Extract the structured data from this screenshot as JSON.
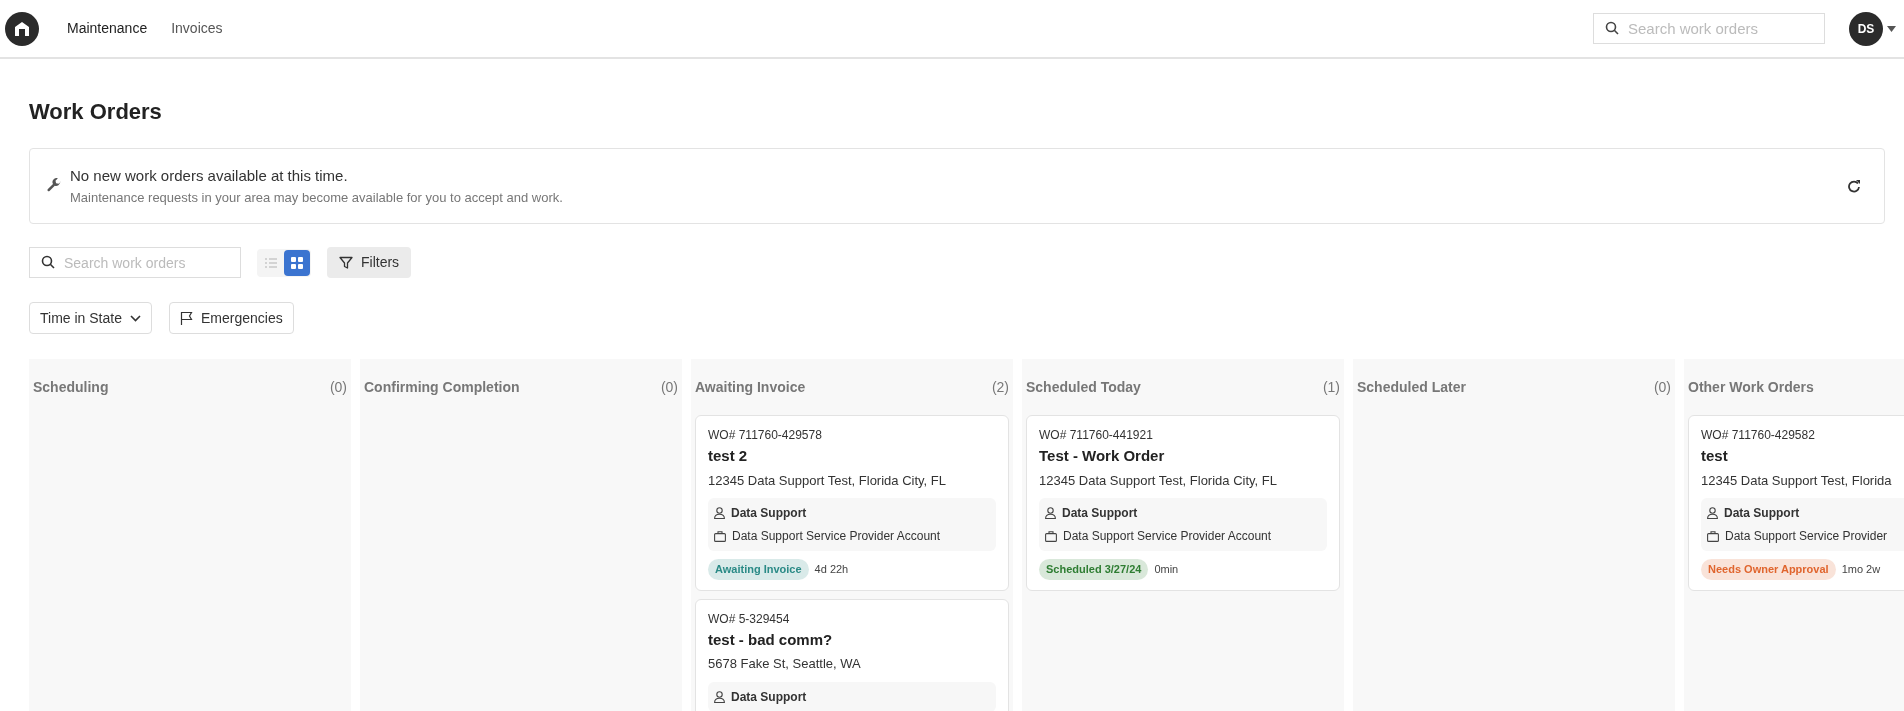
{
  "header": {
    "avatar": "DS",
    "nav": [
      {
        "label": "Maintenance",
        "selected": true
      },
      {
        "label": "Invoices",
        "selected": false
      }
    ],
    "search": {
      "placeholder": "Search work orders"
    }
  },
  "title": "Work Orders",
  "notice": {
    "heading": "No new work orders available at this time.",
    "text": "Maintenance requests in your area may become available for you to accept and work."
  },
  "toolbar": {
    "search": {
      "placeholder": "Search work orders"
    },
    "views": [
      {
        "kind": "list",
        "selected": false
      },
      {
        "kind": "grid",
        "selected": true
      }
    ],
    "filters": "Filters",
    "sort": "Time in State",
    "emergencies": "Emergencies"
  },
  "columns": [
    {
      "title": "Scheduling",
      "count": "(0)"
    },
    {
      "title": "Confirming Completion",
      "count": "(0)"
    },
    {
      "title": "Awaiting Invoice",
      "count": "(2)",
      "cards": [
        {
          "number": "WO# 711760-429578",
          "title": "test 2",
          "address": "12345 Data Support Test, Florida City, FL",
          "contact": "Data Support",
          "account": "Data Support Service Provider Account",
          "status": "Awaiting Invoice",
          "color": "#2a8a86",
          "age": "4d 22h"
        },
        {
          "number": "WO# 5-329454",
          "title": "test - bad comm?",
          "address": "5678 Fake St, Seattle, WA",
          "contact": "Data Support"
        }
      ]
    },
    {
      "title": "Scheduled Today",
      "count": "(1)",
      "cards": [
        {
          "number": "WO# 711760-441921",
          "title": "Test - Work Order",
          "address": "12345 Data Support Test, Florida City, FL",
          "contact": "Data Support",
          "account": "Data Support Service Provider Account",
          "status": "Scheduled 3/27/24",
          "color": "#2e7d32",
          "age": "0min"
        }
      ]
    },
    {
      "title": "Scheduled Later",
      "count": "(0)"
    },
    {
      "title": "Other Work Orders",
      "cards": [
        {
          "number": "WO# 711760-429582",
          "title": "test",
          "address": "12345 Data Support Test, Florida",
          "contact": "Data Support",
          "account": "Data Support Service Provider",
          "status": "Needs Owner Approval",
          "color": "#e0652e",
          "age": "1mo 2w"
        }
      ]
    }
  ]
}
